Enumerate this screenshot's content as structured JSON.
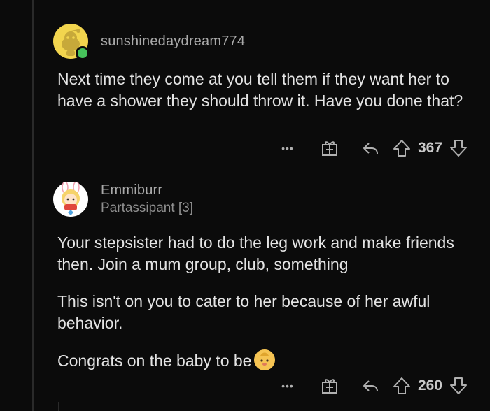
{
  "comments": [
    {
      "username": "sunshinedaydream774",
      "body": [
        "Next time they come at you tell them if they want her to have a shower they should throw it. Have you done that?"
      ],
      "more_label": "•••",
      "score": "367"
    },
    {
      "username": "Emmiburr",
      "flair": "Partassipant [3]",
      "body": [
        "Your stepsister had to do the leg work and make friends then. Join a mum group, club, something",
        "This isn't on you to cater to her because of her awful behavior.",
        "Congrats on the baby to be"
      ],
      "more_label": "•••",
      "score": "260"
    }
  ],
  "icons": {
    "avatar1": "snoo-avatar",
    "avatar2": "custom-avatar",
    "online": "online-status-dot",
    "award": "award-gift-icon",
    "reply": "reply-arrow-icon",
    "upvote": "upvote-arrow-icon",
    "downvote": "downvote-arrow-icon",
    "emoji": "baby-emoji"
  },
  "colors": {
    "background": "#0b0b0b",
    "text": "#e4e4e4",
    "muted": "#a9a9a9",
    "online": "#46c25b"
  }
}
